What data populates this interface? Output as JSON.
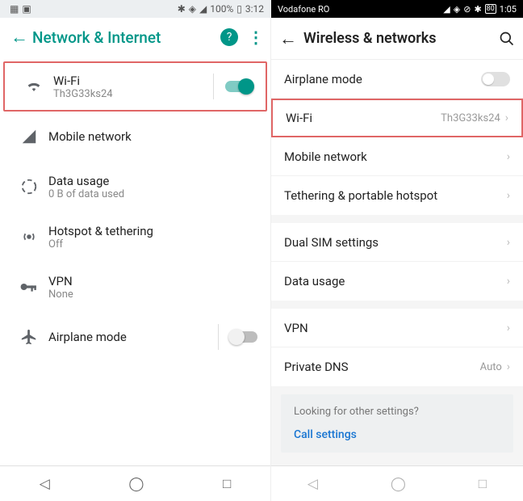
{
  "left": {
    "status": {
      "battery": "100%",
      "time": "3:12"
    },
    "header": {
      "title": "Network & Internet"
    },
    "items": [
      {
        "title": "Wi-Fi",
        "sub": "Th3G33ks24",
        "icon": "wifi-icon",
        "name": "row-wifi",
        "toggle": "on",
        "hl": true
      },
      {
        "title": "Mobile network",
        "sub": "",
        "icon": "signal-icon",
        "name": "row-mobile",
        "toggle": "",
        "hl": false
      },
      {
        "title": "Data usage",
        "sub": "0 B of data used",
        "icon": "data-usage-icon",
        "name": "row-data-usage",
        "toggle": "",
        "hl": false
      },
      {
        "title": "Hotspot & tethering",
        "sub": "Off",
        "icon": "hotspot-icon",
        "name": "row-hotspot",
        "toggle": "",
        "hl": false
      },
      {
        "title": "VPN",
        "sub": "None",
        "icon": "vpn-icon",
        "name": "row-vpn",
        "toggle": "",
        "hl": false
      },
      {
        "title": "Airplane mode",
        "sub": "",
        "icon": "airplane-icon",
        "name": "row-airplane",
        "toggle": "off",
        "hl": false
      }
    ]
  },
  "right": {
    "status": {
      "carrier": "Vodafone RO",
      "time": "1:05",
      "battery": "80"
    },
    "header": {
      "title": "Wireless & networks"
    },
    "groups": [
      [
        {
          "title": "Airplane mode",
          "value": "",
          "name": "row-airplane",
          "toggle": true,
          "chev": false,
          "hl": false
        },
        {
          "title": "Wi-Fi",
          "value": "Th3G33ks24",
          "name": "row-wifi",
          "toggle": false,
          "chev": true,
          "hl": true
        },
        {
          "title": "Mobile network",
          "value": "",
          "name": "row-mobile",
          "toggle": false,
          "chev": true,
          "hl": false
        },
        {
          "title": "Tethering & portable hotspot",
          "value": "",
          "name": "row-tethering",
          "toggle": false,
          "chev": true,
          "hl": false
        }
      ],
      [
        {
          "title": "Dual SIM settings",
          "value": "",
          "name": "row-dual-sim",
          "toggle": false,
          "chev": true,
          "hl": false
        },
        {
          "title": "Data usage",
          "value": "",
          "name": "row-data",
          "toggle": false,
          "chev": true,
          "hl": false
        }
      ],
      [
        {
          "title": "VPN",
          "value": "",
          "name": "row-vpn",
          "toggle": false,
          "chev": true,
          "hl": false
        },
        {
          "title": "Private DNS",
          "value": "Auto",
          "name": "row-private-dns",
          "toggle": false,
          "chev": true,
          "hl": false
        }
      ]
    ],
    "footer": {
      "question": "Looking for other settings?",
      "link": "Call settings"
    }
  }
}
